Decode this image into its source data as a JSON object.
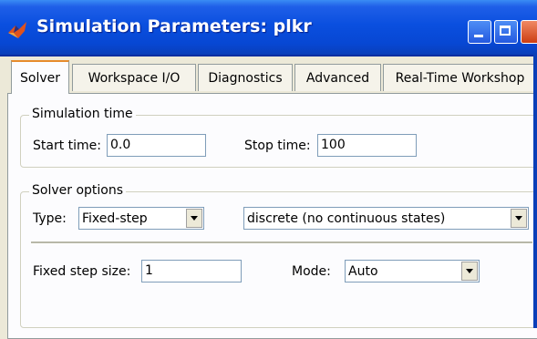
{
  "window": {
    "title": "Simulation Parameters: plkr",
    "icon": "matlab-simulink-icon"
  },
  "tabs": [
    {
      "label": "Solver",
      "active": true
    },
    {
      "label": "Workspace I/O",
      "active": false
    },
    {
      "label": "Diagnostics",
      "active": false
    },
    {
      "label": "Advanced",
      "active": false
    },
    {
      "label": "Real-Time Workshop",
      "active": false
    }
  ],
  "simulation_time": {
    "group_label": "Simulation time",
    "start_label": "Start time:",
    "start_value": "0.0",
    "stop_label": "Stop time:",
    "stop_value": "100"
  },
  "solver_options": {
    "group_label": "Solver options",
    "type_label": "Type:",
    "type_value": "Fixed-step",
    "solver_value": "discrete (no continuous states)",
    "step_size_label": "Fixed step size:",
    "step_size_value": "1",
    "mode_label": "Mode:",
    "mode_value": "Auto"
  },
  "colors": {
    "title_bar": "#0a4fdf",
    "active_tab_accent": "#e68b2c",
    "dialog_background": "#ece9d8"
  }
}
